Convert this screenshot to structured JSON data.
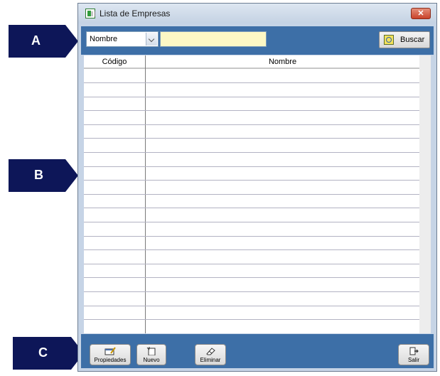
{
  "window": {
    "title": "Lista de Empresas",
    "close_glyph": "✕"
  },
  "search": {
    "field_value": "Nombre",
    "input_value": "",
    "button_label": "Buscar",
    "button_icon": "search-icon"
  },
  "table": {
    "columns": [
      {
        "label": "Código"
      },
      {
        "label": "Nombre"
      }
    ],
    "rows": []
  },
  "toolbar": {
    "buttons": [
      {
        "label": "Propiedades",
        "icon": "properties-icon"
      },
      {
        "label": "Nuevo",
        "icon": "new-icon"
      },
      {
        "label": "Eliminar",
        "icon": "eraser-icon"
      },
      {
        "label": "Salir",
        "icon": "exit-icon"
      }
    ]
  },
  "callouts": {
    "a": "A",
    "b": "B",
    "c": "C"
  },
  "colors": {
    "callout": "#0d1658",
    "panel": "#3d6fa7",
    "window": "#c6d4e6",
    "search_input": "#fdf8c5"
  }
}
